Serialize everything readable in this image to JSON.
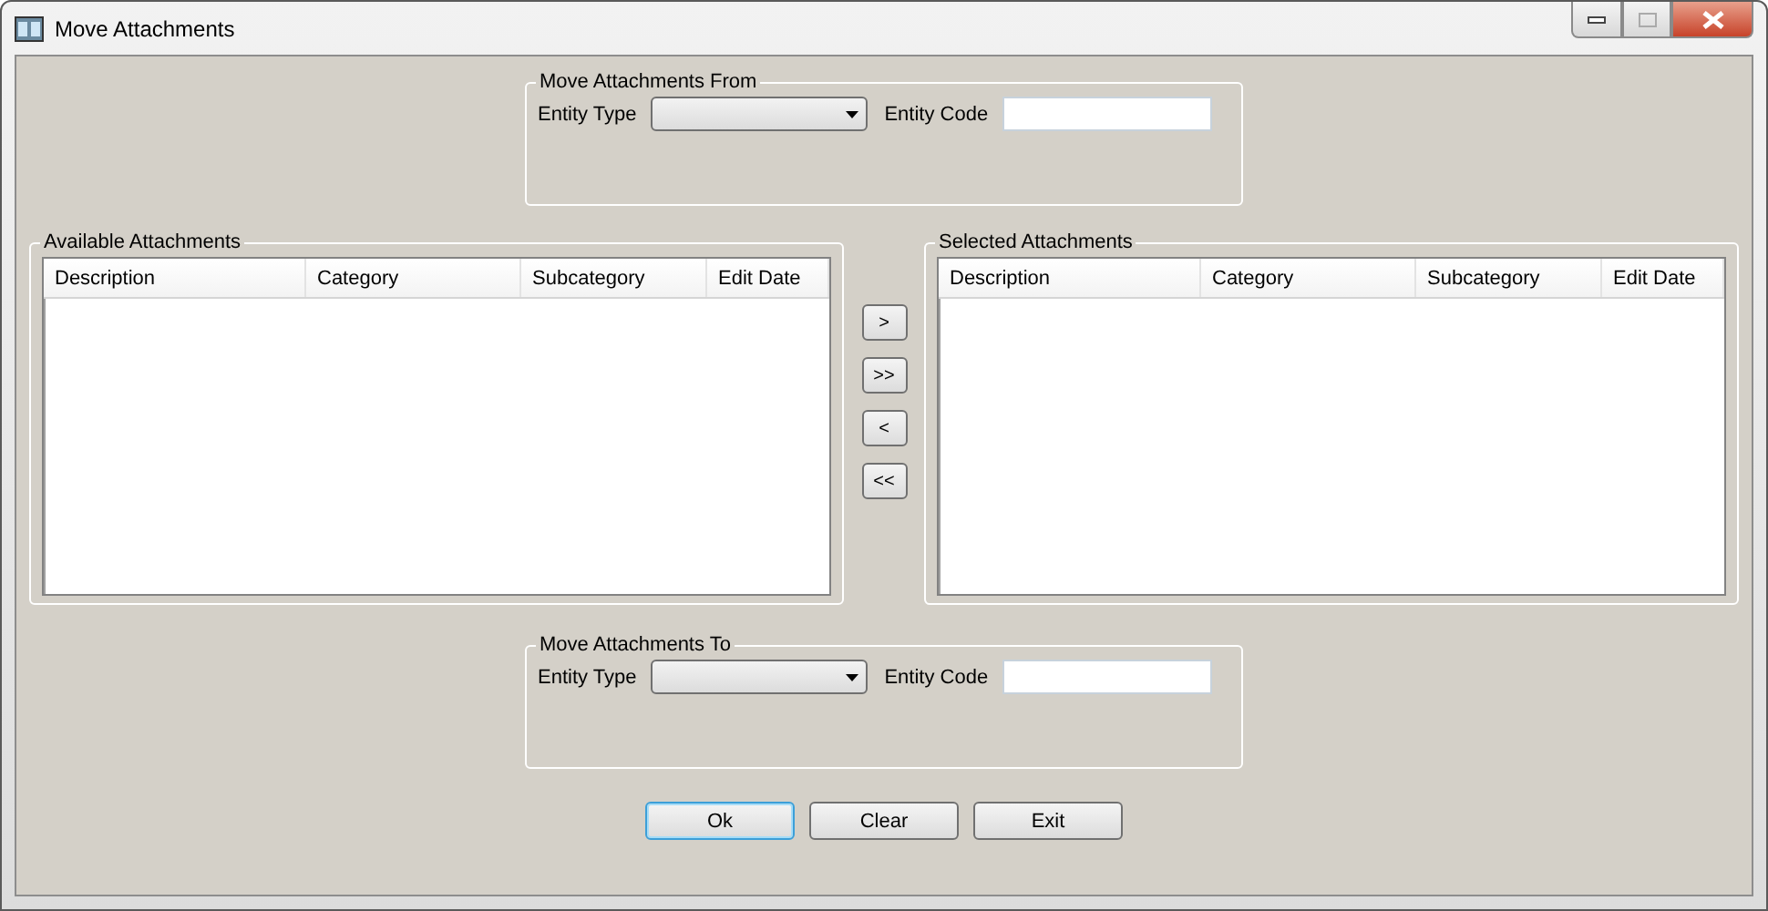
{
  "window": {
    "title": "Move Attachments"
  },
  "move_from": {
    "title": "Move Attachments From",
    "entity_type_label": "Entity Type",
    "entity_code_label": "Entity Code"
  },
  "available": {
    "title": "Available Attachments",
    "columns": [
      "Description",
      "Category",
      "Subcategory",
      "Edit Date"
    ]
  },
  "transfer_buttons": [
    ">",
    ">>",
    "<",
    "<<"
  ],
  "selected": {
    "title": "Selected Attachments",
    "columns": [
      "Description",
      "Category",
      "Subcategory",
      "Edit Date"
    ]
  },
  "move_to": {
    "title": "Move Attachments To",
    "entity_type_label": "Entity Type",
    "entity_code_label": "Entity Code"
  },
  "buttons": [
    {
      "label": "Ok",
      "focused": true
    },
    {
      "label": "Clear",
      "focused": false
    },
    {
      "label": "Exit",
      "focused": false
    }
  ]
}
